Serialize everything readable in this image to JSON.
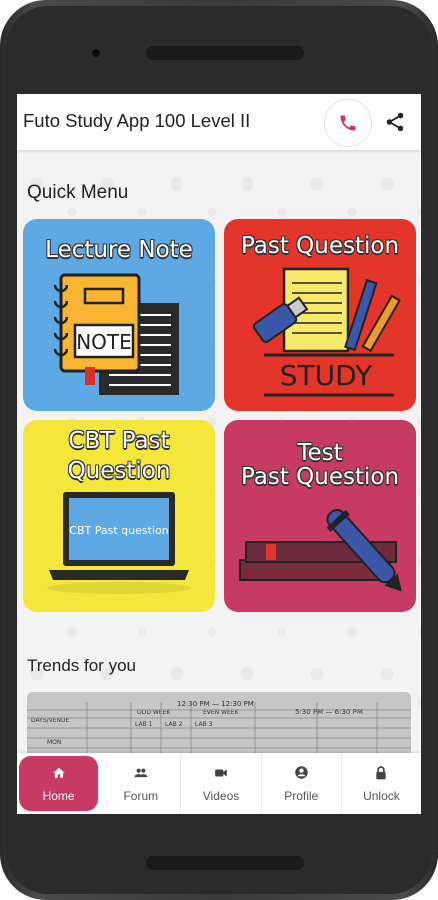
{
  "app": {
    "title": "Futo Study App 100 Level II"
  },
  "quick_menu": {
    "title": "Quick Menu",
    "tiles": [
      {
        "label": "Lecture Note",
        "image_text": "NOTE",
        "color": "#5ea8e3"
      },
      {
        "label": "Past Question",
        "image_text": "STUDY",
        "color": "#e3352a"
      },
      {
        "label_line1": "CBT Past",
        "label_line2": "Question",
        "screen_text": "CBT Past question",
        "color": "#f4e63b"
      },
      {
        "label_line1": "Test",
        "label_line2": "Past Question",
        "color": "#c63a63"
      }
    ]
  },
  "trends": {
    "title": "Trends for you",
    "image_text": {
      "time1": "12:30 PM — 12:30 PM",
      "time2": "5:30 PM — 6:30 PM",
      "odd_week": "ODD WEEK",
      "even_week": "EVEN WEEK",
      "days": "DAYS/VENUE",
      "lab1": "LAB 1",
      "lab2": "LAB 2",
      "lab3": "LAB 3",
      "mon": "MON"
    }
  },
  "bottom_nav": {
    "items": [
      {
        "label": "Home",
        "icon": "home-icon",
        "active": true
      },
      {
        "label": "Forum",
        "icon": "people-icon"
      },
      {
        "label": "Videos",
        "icon": "video-camera-icon"
      },
      {
        "label": "Profile",
        "icon": "account-circle-icon"
      },
      {
        "label": "Unlock",
        "icon": "lock-icon"
      }
    ]
  },
  "colors": {
    "accent": "#c63a63"
  }
}
